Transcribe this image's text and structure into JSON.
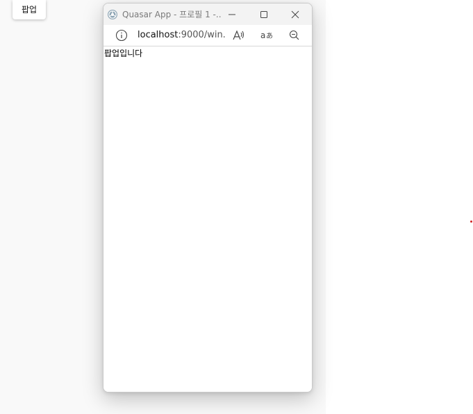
{
  "host": {
    "popup_button_label": "팝업"
  },
  "popup": {
    "title": "Quasar App - 프로필 1 -...",
    "url_host": "localhost",
    "url_rest": ":9000/win...",
    "body_text": "팝업입니다"
  },
  "icons": {
    "app": "edge-browser-icon",
    "minimize": "minimize-icon",
    "maximize": "maximize-icon",
    "close": "close-icon",
    "info": "info-icon",
    "read_aloud": "read-aloud-icon",
    "translate": "translate-icon",
    "zoom_out": "zoom-out-icon"
  },
  "colors": {
    "title_text": "#7a7a7a",
    "title_bar_bg": "#f3f3f3",
    "host_bg": "#f9f9f9",
    "dot": "#d02020"
  }
}
